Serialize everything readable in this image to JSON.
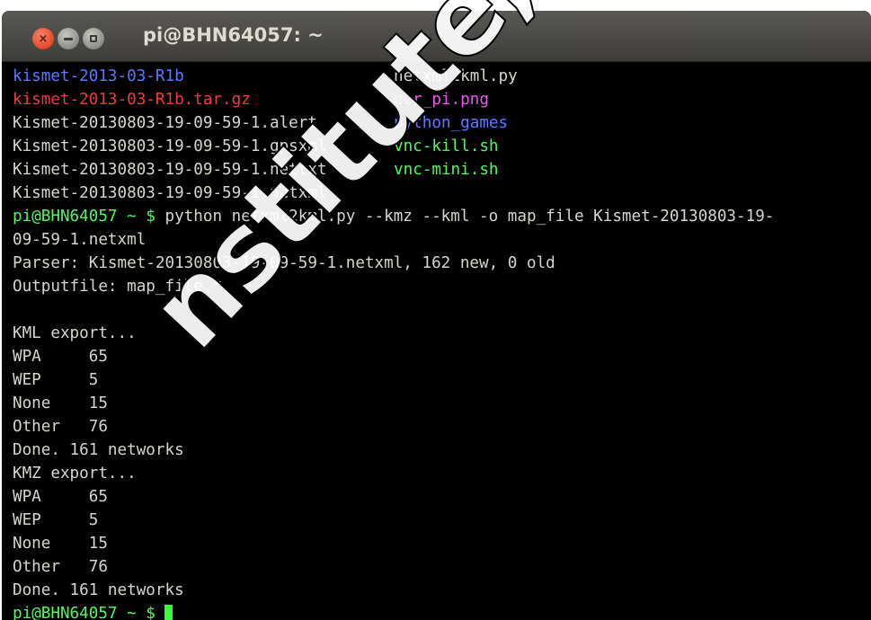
{
  "window": {
    "title": "pi@BHN64057: ~",
    "buttons": {
      "close": "×"
    }
  },
  "terminal": {
    "ls_rows": [
      {
        "left": "kismet-2013-03-R1b",
        "left_color": "blue",
        "right": "netxml2kml.py",
        "right_color": "plain"
      },
      {
        "left": "kismet-2013-03-R1b.tar.gz",
        "left_color": "red",
        "right": "ocr_pi.png",
        "right_color": "pink"
      },
      {
        "left": "Kismet-20130803-19-09-59-1.alert",
        "left_color": "plain",
        "right": "python_games",
        "right_color": "blue"
      },
      {
        "left": "Kismet-20130803-19-09-59-1.gpsxml",
        "left_color": "plain",
        "right": "vnc-kill.sh",
        "right_color": "green"
      },
      {
        "left": "Kismet-20130803-19-09-59-1.nettxt",
        "left_color": "plain",
        "right": "vnc-mini.sh",
        "right_color": "green"
      },
      {
        "left": "Kismet-20130803-19-09-59-1.netxml",
        "left_color": "plain",
        "right": "",
        "right_color": "plain"
      }
    ],
    "prompt": "pi@BHN64057 ~ $",
    "command": " python netxml2kml.py --kmz --kml -o map_file Kismet-20130803-19-",
    "command_wrap": "09-59-1.netxml",
    "output": [
      "Parser: Kismet-20130803-19-09-59-1.netxml, 162 new, 0 old",
      "Outputfile: map_file.*",
      "",
      "KML export...",
      "WPA     65",
      "WEP     5",
      "None    15",
      "Other   76",
      "Done. 161 networks",
      "KMZ export...",
      "WPA     65",
      "WEP     5",
      "None    15",
      "Other   76",
      "Done. 161 networks"
    ],
    "final_prompt": "pi@BHN64057 ~ $",
    "colors": {
      "blue": "#5c79ff",
      "red": "#ef3b3b",
      "pink": "#ee55ee",
      "green": "#55f55f",
      "plain": "#d3d7cf",
      "background": "#000000"
    }
  },
  "watermark": "nstitute, Author retains f"
}
